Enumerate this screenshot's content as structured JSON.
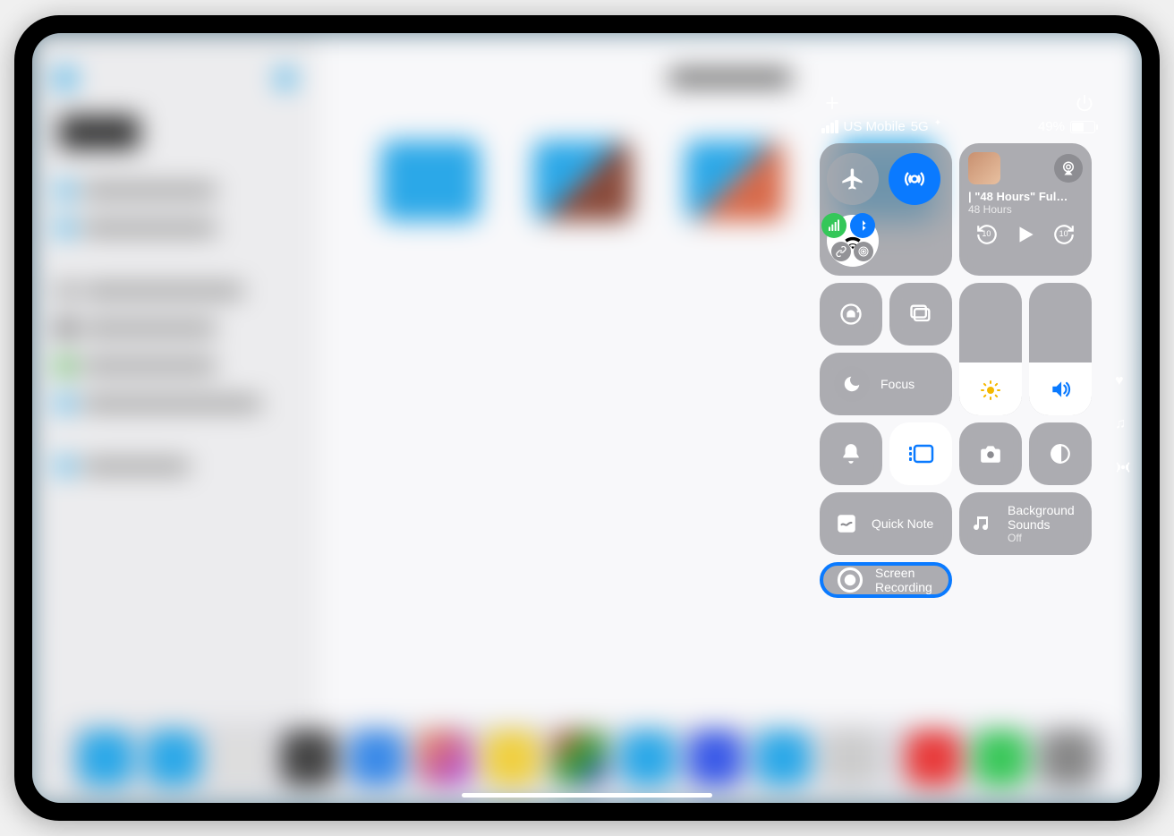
{
  "status": {
    "carrier": "US Mobile",
    "network": "5G",
    "battery_pct": "49%"
  },
  "connectivity": {
    "airplane": "airplane-icon",
    "airdrop": "airdrop-icon",
    "wifi": "wifi-icon",
    "cellular": "cellular-icon",
    "bluetooth": "bluetooth-icon",
    "vpn": "vpn-icon",
    "hotspot": "hotspot-icon"
  },
  "media": {
    "title": "| \"48 Hours\" Ful…",
    "subtitle": "48 Hours",
    "back_label": "10",
    "fwd_label": "10"
  },
  "focus_label": "Focus",
  "quicknote_label": "Quick Note",
  "bg_sounds": {
    "title": "Background Sounds",
    "state": "Off"
  },
  "screen_recording": {
    "line1": "Screen",
    "line2": "Recording"
  },
  "sliders": {
    "brightness_pct": 40,
    "volume_pct": 40
  },
  "colors": {
    "accent_blue": "#0a7aff",
    "module_gray": "rgba(140,140,145,.7)",
    "green": "#34c759"
  }
}
